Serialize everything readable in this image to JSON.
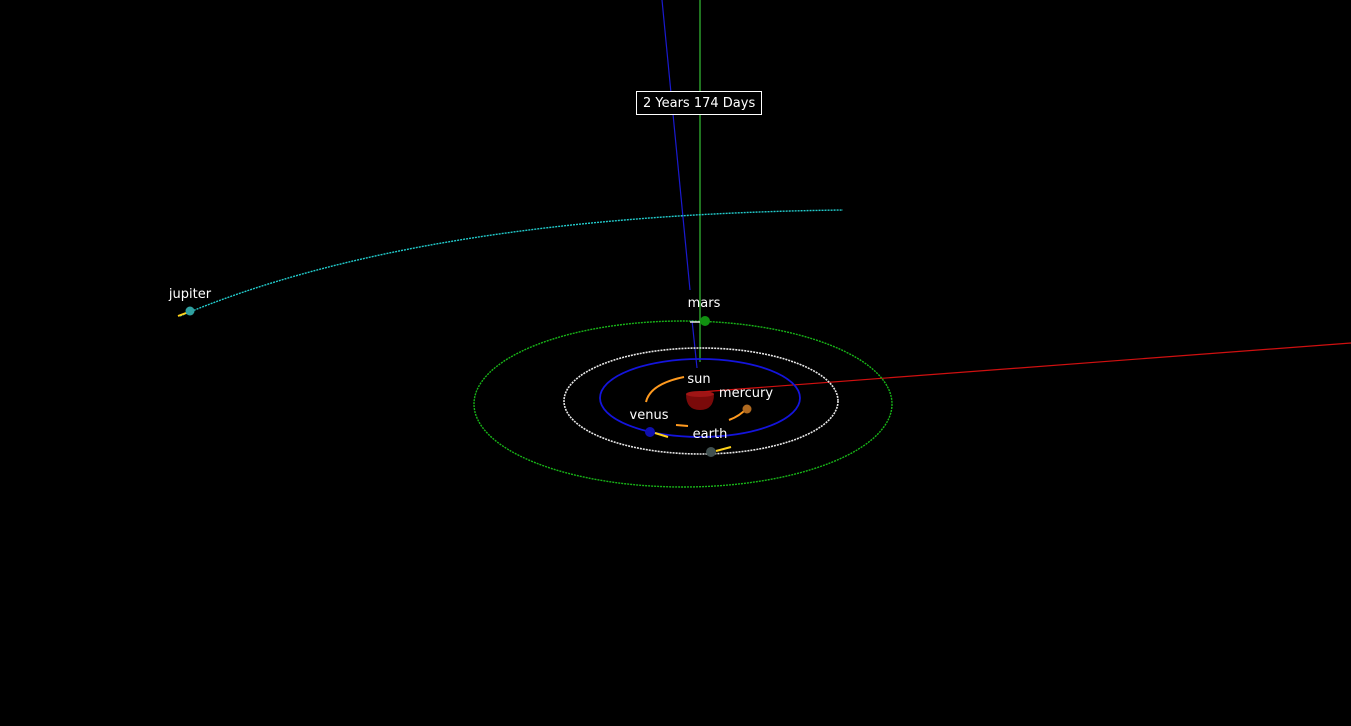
{
  "time_display": "2 Years 174 Days",
  "bodies": {
    "sun": {
      "label": "sun",
      "color": "#7a0a0a"
    },
    "mercury": {
      "label": "mercury",
      "color": "#b06a20"
    },
    "venus": {
      "label": "venus",
      "color": "#1010b0"
    },
    "earth": {
      "label": "earth",
      "color": "#405050"
    },
    "mars": {
      "label": "mars",
      "color": "#109010"
    },
    "jupiter": {
      "label": "jupiter",
      "color": "#30a0a0"
    }
  },
  "orbit_colors": {
    "venus": "#1414dc",
    "earth": "#e8e8e8",
    "mars": "#18b418",
    "jupiter": "#22cccc",
    "mercury": "#ff9a1f"
  },
  "axis_colors": {
    "x": "#d01010",
    "y": "#2a9a2a",
    "z": "#1a1ad0"
  }
}
